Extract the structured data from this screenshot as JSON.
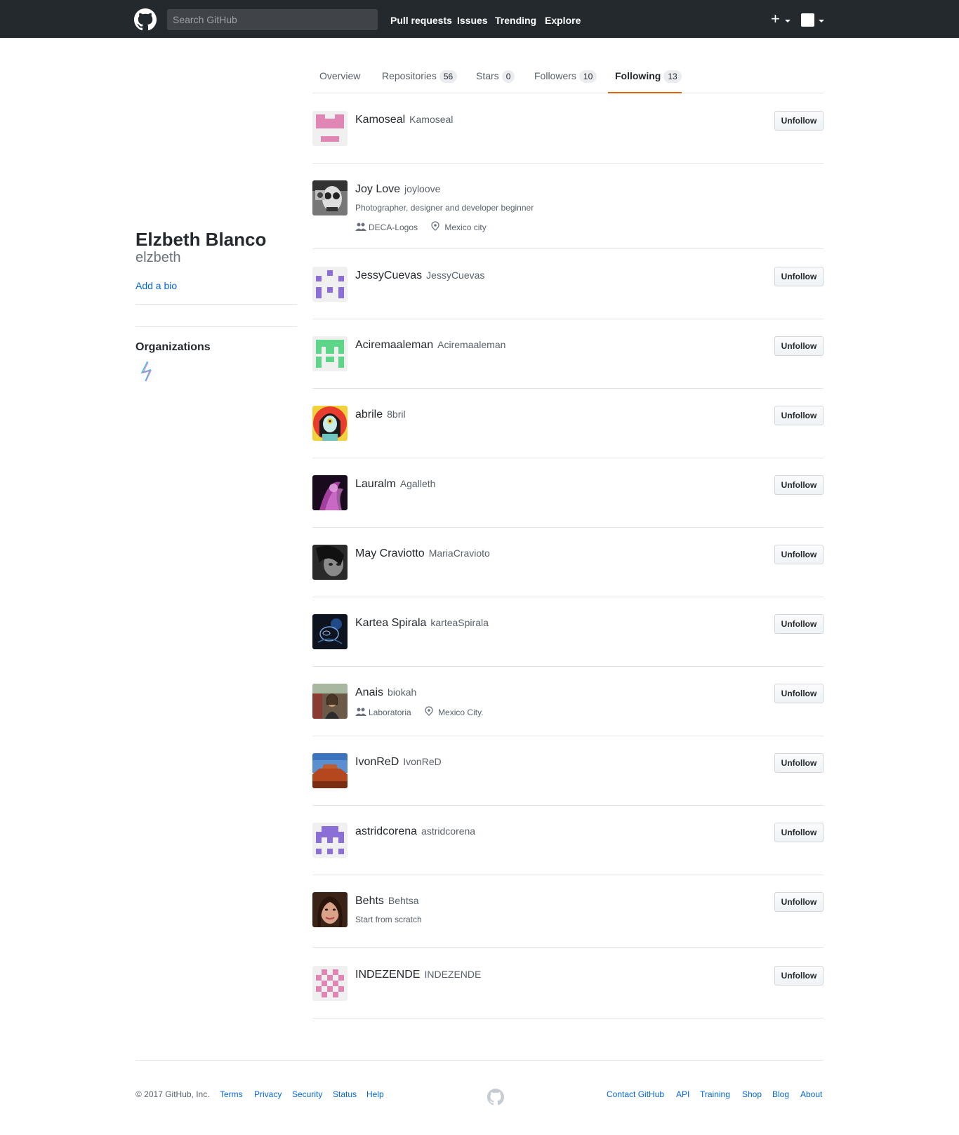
{
  "header": {
    "search_placeholder": "Search GitHub",
    "nav": [
      "Pull requests",
      "Issues",
      "Trending",
      "Explore"
    ],
    "plus_label": "+"
  },
  "profile": {
    "name": "Elzbeth Blanco",
    "login": "elzbeth",
    "bio_link": "Add a bio",
    "organizations_title": "Organizations"
  },
  "tabs": [
    {
      "label": "Overview",
      "count": ""
    },
    {
      "label": "Repositories",
      "count": "56"
    },
    {
      "label": "Stars",
      "count": "0"
    },
    {
      "label": "Followers",
      "count": "10"
    },
    {
      "label": "Following",
      "count": "13",
      "selected": true
    }
  ],
  "unfollow_label": "Unfollow",
  "following": [
    {
      "name": "Kamoseal",
      "login": "Kamoseal",
      "avatar": "identicon-pink-1"
    },
    {
      "name": "Joy Love",
      "login": "joyloove",
      "bio": "Photographer, designer and developer beginner",
      "company": "DECA-Logos",
      "location": "Mexico city",
      "avatar": "photo-skull"
    },
    {
      "name": "JessyCuevas",
      "login": "JessyCuevas",
      "avatar": "identicon-purple-1"
    },
    {
      "name": "Aciremaaleman",
      "login": "Aciremaaleman",
      "avatar": "identicon-green"
    },
    {
      "name": "abrile",
      "login": "8bril",
      "avatar": "illustration-red"
    },
    {
      "name": "Lauralm",
      "login": "Agalleth",
      "avatar": "photo-purple"
    },
    {
      "name": "May Craviotto",
      "login": "MariaCravioto",
      "avatar": "photo-face-dark"
    },
    {
      "name": "Kartea Spirala",
      "login": "karteaSpirala",
      "avatar": "photo-blue-dark"
    },
    {
      "name": "Anais",
      "login": "biokah",
      "company": "Laboratoria",
      "location": "Mexico City.",
      "avatar": "photo-street"
    },
    {
      "name": "IvonReD",
      "login": "IvonReD",
      "avatar": "photo-landscape"
    },
    {
      "name": "astridcorena",
      "login": "astridcorena",
      "avatar": "identicon-purple-2"
    },
    {
      "name": "Behts",
      "login": "Behtsa",
      "bio": "Start from scratch",
      "avatar": "photo-face-smile"
    },
    {
      "name": "INDEZENDE",
      "login": "INDEZENDE",
      "avatar": "identicon-pink-2"
    }
  ],
  "footer": {
    "copyright": "© 2017 GitHub, Inc.",
    "left_links": [
      "Terms",
      "Privacy",
      "Security",
      "Status",
      "Help"
    ],
    "right_links": [
      "Contact GitHub",
      "API",
      "Training",
      "Shop",
      "Blog",
      "About"
    ]
  }
}
